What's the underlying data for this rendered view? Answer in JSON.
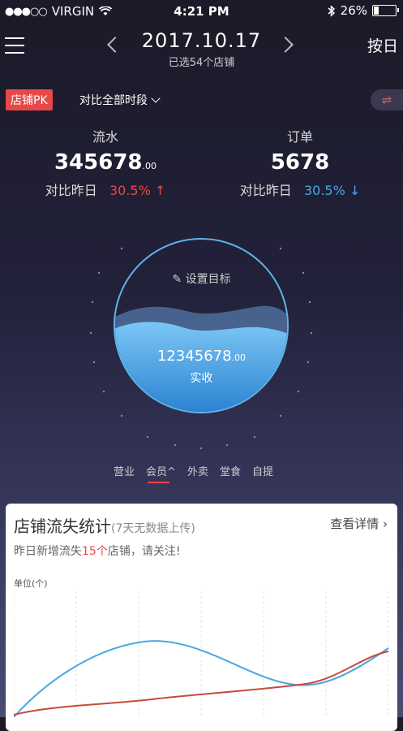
{
  "status_bar": {
    "carrier": "VIRGIN",
    "signal_dots": "●●●○○",
    "time": "4:21 PM",
    "battery": "26%",
    "battery_level": 0.26
  },
  "nav": {
    "date": "2017.10.17",
    "subtitle": "已选54个店铺",
    "right_action": "按日"
  },
  "toolbar": {
    "pk_label": "店铺PK",
    "compare_label": "对比全部时段",
    "swap_icon": "⇌"
  },
  "metrics": {
    "revenue": {
      "label": "流水",
      "value": "345678",
      "decimals": ".00",
      "compare_label": "对比昨日",
      "change": "30.5%",
      "arrow": "↑",
      "direction": "up"
    },
    "orders": {
      "label": "订单",
      "value": "5678",
      "compare_label": "对比昨日",
      "change": "30.5%",
      "arrow": "↓",
      "direction": "down"
    }
  },
  "goal": {
    "set_label": "设置目标",
    "actual_value": "12345678",
    "actual_decimals": ".00",
    "actual_label": "实收"
  },
  "tabs": [
    {
      "label": "营业",
      "active": false
    },
    {
      "label": "会员^",
      "active": true
    },
    {
      "label": "外卖",
      "active": false
    },
    {
      "label": "堂食",
      "active": false
    },
    {
      "label": "自提",
      "active": false
    }
  ],
  "card": {
    "title": "店铺流失统计",
    "note": "(7天无数据上传)",
    "detail_link": "查看详情",
    "alert_prefix": "昨日新增流失",
    "alert_count": "15个",
    "alert_suffix": "店铺，请关注!",
    "unit_label": "单位(个)"
  },
  "colors": {
    "accent_red": "#e84848",
    "accent_blue": "#4aa8e0"
  }
}
